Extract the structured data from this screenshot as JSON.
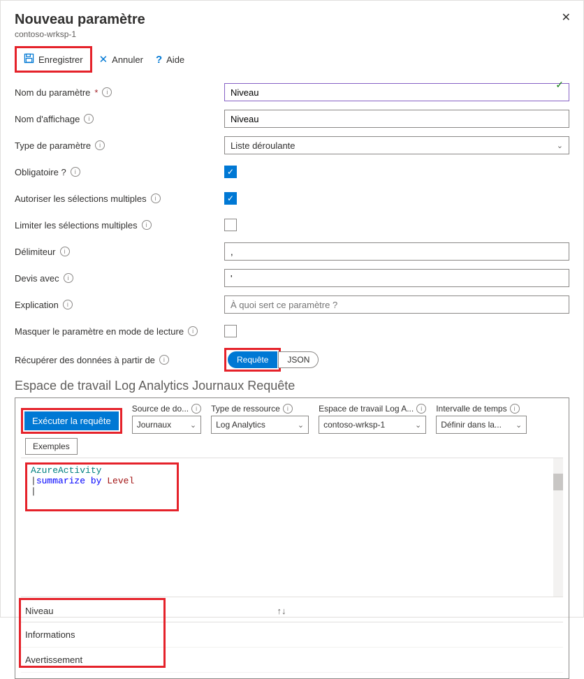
{
  "header": {
    "title": "Nouveau paramètre",
    "subtitle": "contoso-wrksp-1"
  },
  "toolbar": {
    "save": "Enregistrer",
    "cancel": "Annuler",
    "help": "Aide"
  },
  "form": {
    "paramName": {
      "label": "Nom du paramètre",
      "value": "Niveau"
    },
    "displayName": {
      "label": "Nom d'affichage",
      "value": "Niveau"
    },
    "paramType": {
      "label": "Type de paramètre",
      "value": "Liste déroulante"
    },
    "required": {
      "label": "Obligatoire ?",
      "checked": true
    },
    "multi": {
      "label": "Autoriser les sélections multiples",
      "checked": true
    },
    "limitMulti": {
      "label": "Limiter les sélections multiples",
      "checked": false
    },
    "delimiter": {
      "label": "Délimiteur",
      "value": ","
    },
    "quoteWith": {
      "label": "Devis avec",
      "value": "'"
    },
    "explanation": {
      "label": "Explication",
      "placeholder": "À quoi sert ce paramètre ?"
    },
    "hideReadMode": {
      "label": "Masquer le paramètre en mode de lecture",
      "checked": false
    },
    "getDataFrom": {
      "label": "Récupérer des données à partir de",
      "opt1": "Requête",
      "opt2": "JSON"
    }
  },
  "querySection": {
    "heading": "Espace de travail Log Analytics Journaux Requête",
    "runBtn": "Exécuter la requête",
    "dataSource": {
      "label": "Source de do...",
      "value": "Journaux"
    },
    "resourceType": {
      "label": "Type de ressource",
      "value": "Log Analytics"
    },
    "workspace": {
      "label": "Espace de travail Log A...",
      "value": "contoso-wrksp-1"
    },
    "timeRange": {
      "label": "Intervalle de temps",
      "value": "Définir dans la..."
    },
    "examples": "Exemples",
    "code": {
      "t1": "AzureActivity",
      "t2": "summarize by",
      "t3": "Level"
    }
  },
  "results": {
    "header": "Niveau",
    "rows": [
      "Informations",
      "Avertissement"
    ]
  }
}
